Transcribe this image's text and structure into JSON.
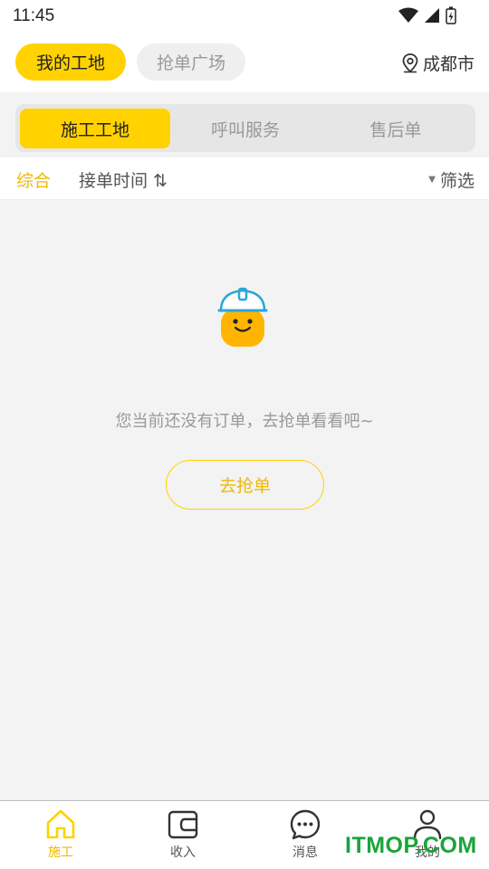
{
  "status_bar": {
    "time": "11:45"
  },
  "header": {
    "tabs": [
      {
        "label": "我的工地",
        "active": true
      },
      {
        "label": "抢单广场",
        "active": false
      }
    ],
    "location": "成都市",
    "location_icon": "location-pin-icon"
  },
  "segment": {
    "items": [
      {
        "label": "施工工地",
        "active": true
      },
      {
        "label": "呼叫服务",
        "active": false
      },
      {
        "label": "售后单",
        "active": false
      }
    ]
  },
  "filter": {
    "sort": "综合",
    "time_sort": "接单时间 ⇅",
    "screen": "筛选"
  },
  "empty": {
    "message": "您当前还没有订单，去抢单看看吧~",
    "button": "去抢单"
  },
  "tabbar": {
    "items": [
      {
        "label": "施工",
        "icon": "home-icon",
        "active": true
      },
      {
        "label": "收入",
        "icon": "wallet-icon",
        "active": false
      },
      {
        "label": "消息",
        "icon": "message-icon",
        "active": false
      },
      {
        "label": "我的",
        "icon": "user-icon",
        "active": false
      }
    ]
  },
  "watermark": "ITMOP.COM",
  "colors": {
    "accent": "#ffd200",
    "accent_text": "#f0b800",
    "watermark": "#1aa43a"
  }
}
